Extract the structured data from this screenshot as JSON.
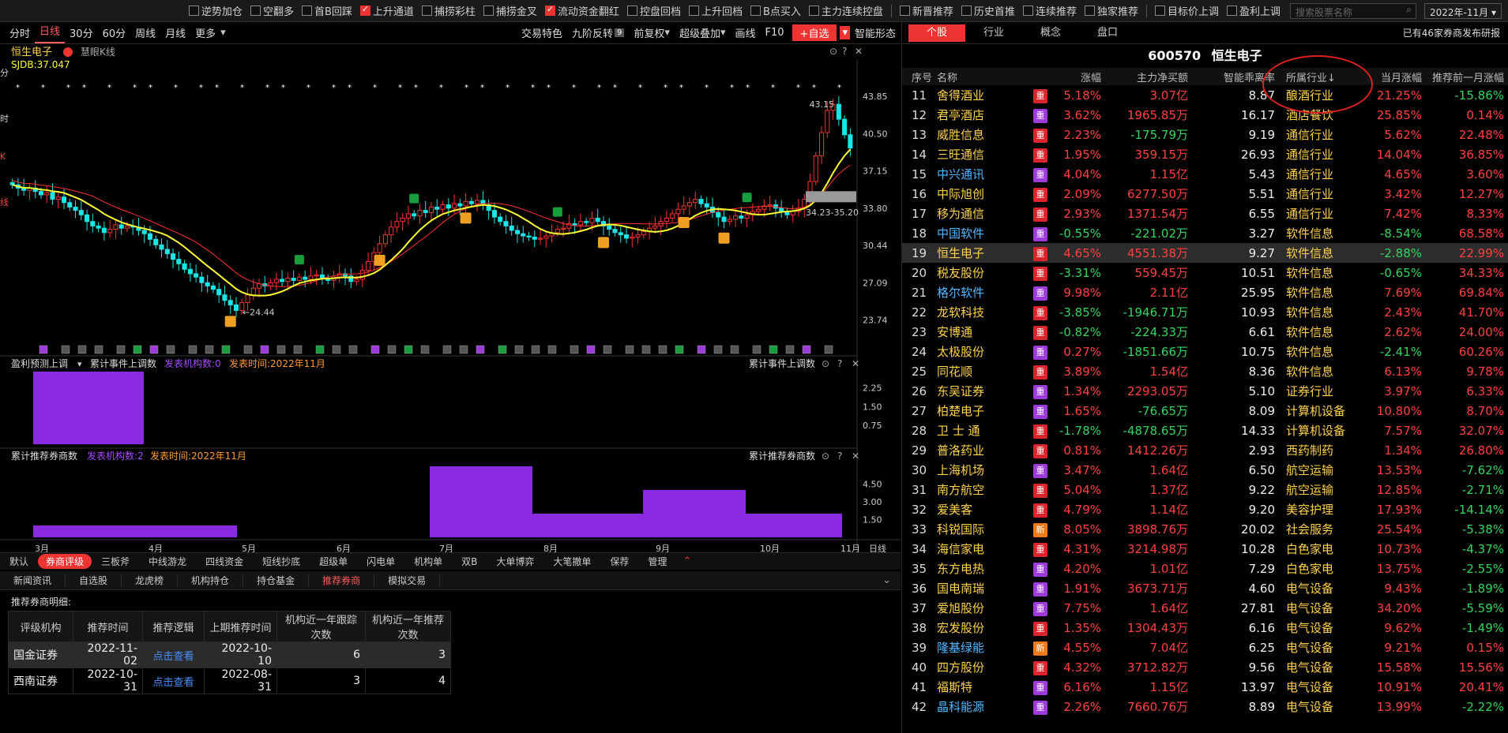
{
  "topbar": {
    "filters": [
      {
        "label": "逆势加仓",
        "checked": false
      },
      {
        "label": "空翻多",
        "checked": false
      },
      {
        "label": "首B回踩",
        "checked": false
      },
      {
        "label": "上升通道",
        "checked": true
      },
      {
        "label": "捕捞彩柱",
        "checked": false
      },
      {
        "label": "捕捞金叉",
        "checked": false
      },
      {
        "label": "流动资金翻红",
        "checked": true
      },
      {
        "label": "控盘回档",
        "checked": false
      },
      {
        "label": "上升回档",
        "checked": false
      },
      {
        "label": "B点买入",
        "checked": false
      },
      {
        "label": "主力连续控盘",
        "checked": false
      }
    ],
    "filters2": [
      {
        "label": "新晋推荐",
        "checked": false
      },
      {
        "label": "历史首推",
        "checked": false
      },
      {
        "label": "连续推荐",
        "checked": false
      },
      {
        "label": "独家推荐",
        "checked": false
      }
    ],
    "filters3": [
      {
        "label": "目标价上调",
        "checked": false
      },
      {
        "label": "盈利上调",
        "checked": false
      }
    ],
    "search_placeholder": "搜索股票名称",
    "date": "2022年-11月"
  },
  "left_toolbar": {
    "tabs_left": [
      "分时",
      "日线",
      "30分",
      "60分",
      "周线",
      "月线",
      "更多"
    ],
    "selected": "日线",
    "tabs_right": [
      "交易特色",
      "九阶反转",
      "前复权",
      "超级叠加",
      "画线",
      "F10"
    ],
    "nine_badge": "9",
    "add_label": "+自选",
    "smart_label": "智能形态"
  },
  "chart_header": {
    "stock_name": "恒生电子",
    "sub": "慧眼K线",
    "sjdb": "SJDB:37.047",
    "side_labels": [
      "分",
      "时",
      "K",
      "线"
    ]
  },
  "chart_data": [
    {
      "type": "candlestick",
      "y_ticks": [
        43.85,
        40.5,
        37.15,
        33.8,
        30.44,
        27.09,
        23.74
      ],
      "ylim": [
        23.0,
        45.0
      ],
      "annotations": [
        {
          "label": "43.15"
        },
        {
          "label": "24.44"
        },
        {
          "label": "34.23-35.20"
        }
      ],
      "x_labels": [
        "3月",
        "4月",
        "5月",
        "6月",
        "7月",
        "8月",
        "9月",
        "10月",
        "11月"
      ],
      "period_label": "日线",
      "close": [
        35.9,
        35.6,
        35.4,
        35.6,
        35.3,
        35.0,
        35.2,
        34.6,
        34.8,
        34.3,
        33.9,
        33.6,
        33.2,
        32.6,
        32.2,
        32.0,
        31.6,
        31.9,
        32.3,
        32.0,
        32.2,
        32.1,
        31.8,
        31.5,
        31.0,
        30.5,
        30.1,
        29.7,
        29.2,
        28.8,
        28.3,
        27.9,
        27.6,
        27.1,
        26.8,
        26.5,
        26.0,
        25.5,
        25.1,
        24.6,
        25.3,
        26.0,
        26.6,
        27.0,
        26.8,
        27.1,
        27.4,
        27.2,
        27.5,
        27.3,
        27.6,
        27.4,
        27.7,
        27.8,
        27.5,
        27.3,
        27.6,
        27.9,
        27.7,
        27.2,
        27.4,
        28.2,
        29.0,
        29.8,
        30.6,
        31.4,
        32.1,
        32.6,
        32.9,
        33.3,
        33.1,
        33.6,
        33.4,
        33.9,
        33.7,
        34.1,
        33.8,
        34.2,
        34.0,
        34.4,
        34.2,
        34.5,
        34.1,
        33.6,
        33.0,
        32.6,
        32.2,
        31.8,
        31.5,
        31.3,
        31.2,
        31.0,
        31.1,
        31.3,
        31.6,
        31.9,
        32.0,
        32.4,
        32.3,
        32.6,
        32.5,
        32.9,
        32.6,
        32.2,
        31.9,
        31.6,
        31.4,
        31.1,
        31.2,
        31.4,
        31.7,
        32.0,
        32.2,
        32.6,
        32.9,
        33.3,
        33.7,
        34.0,
        34.3,
        34.6,
        34.2,
        33.9,
        33.4,
        33.0,
        32.6,
        32.8,
        33.1,
        32.9,
        33.2,
        33.5,
        33.7,
        34.0,
        34.1,
        33.8,
        33.5,
        33.2,
        33.5,
        33.8,
        34.6,
        36.2,
        38.5,
        40.6,
        42.6,
        43.15,
        41.8,
        40.4,
        39.2
      ]
    },
    {
      "type": "bar",
      "title": "盈利预测上调",
      "legend": "累计事件上调数",
      "count_label": "发表机构数:0",
      "time_label": "发表时间:2022年11月",
      "right_title": "累计事件上调数",
      "y_ticks": [
        2.25,
        1.5,
        0.75
      ],
      "ylim": [
        0,
        2.9
      ],
      "categories": [
        "3月",
        "4月"
      ],
      "values": [
        3,
        0
      ]
    },
    {
      "type": "bar",
      "title": "累计推荐券商数",
      "count_label": "发表机构数:2",
      "time_label": "发表时间:2022年11月",
      "right_title": "累计推荐券商数",
      "y_ticks": [
        4.5,
        3.0,
        1.5
      ],
      "ylim": [
        0,
        6.2
      ],
      "categories": [
        "3月",
        "4月",
        "5月",
        "6月",
        "7月",
        "8月",
        "9月",
        "10月",
        "11月"
      ],
      "values": [
        1,
        1,
        0,
        0,
        6,
        2,
        4,
        2,
        2
      ]
    }
  ],
  "bottom_tabs": {
    "row1": [
      "默认",
      "券商评级",
      "三板斧",
      "中线游龙",
      "四线资金",
      "短线抄底",
      "超级单",
      "闪电单",
      "机构单",
      "双B",
      "大单博弈",
      "大笔撤单",
      "保荐",
      "管理"
    ],
    "row1_selected": "券商评级",
    "row2": [
      "新闻资讯",
      "自选股",
      "龙虎榜",
      "机构持仓",
      "持仓基金",
      "推荐券商",
      "模拟交易"
    ],
    "row2_selected": "推荐券商"
  },
  "broker_table": {
    "subtitle": "推荐券商明细:",
    "headers": [
      "评级机构",
      "推荐时间",
      "推荐逻辑",
      "上期推荐时间",
      "机构近一年跟踪次数",
      "机构近一年推荐次数"
    ],
    "rows": [
      [
        "国金证券",
        "2022-11-02",
        "点击查看",
        "2022-10-10",
        "6",
        "3"
      ],
      [
        "西南证券",
        "2022-10-31",
        "点击查看",
        "2022-08-31",
        "3",
        "4"
      ]
    ]
  },
  "right_panel": {
    "tabs": [
      "个股",
      "行业",
      "概念",
      "盘口"
    ],
    "selected": "个股",
    "note": "已有46家券商发布研报",
    "code": "600570",
    "name": "恒生电子",
    "headers": [
      "序号",
      "名称",
      "",
      "涨幅",
      "主力净买额",
      "智能乖离率",
      "所属行业↓",
      "当月涨幅",
      "推荐前一月涨幅"
    ],
    "rows": [
      [
        "11",
        "舍得酒业",
        "重",
        "5.18%",
        "3.07亿",
        "8.87",
        "酿酒行业",
        "21.25%",
        "-15.86%"
      ],
      [
        "12",
        "君亭酒店",
        "重",
        "3.62%",
        "1965.85万",
        "16.17",
        "酒店餐饮",
        "25.85%",
        "0.14%"
      ],
      [
        "13",
        "威胜信息",
        "重",
        "2.23%",
        "-175.79万",
        "9.19",
        "通信行业",
        "5.62%",
        "22.48%"
      ],
      [
        "14",
        "三旺通信",
        "重",
        "1.95%",
        "359.15万",
        "26.93",
        "通信行业",
        "14.04%",
        "36.85%"
      ],
      [
        "15",
        "中兴通讯",
        "重",
        "4.04%",
        "1.15亿",
        "5.43",
        "通信行业",
        "4.65%",
        "3.60%"
      ],
      [
        "16",
        "中际旭创",
        "重",
        "2.09%",
        "6277.50万",
        "5.51",
        "通信行业",
        "3.42%",
        "12.27%"
      ],
      [
        "17",
        "移为通信",
        "重",
        "2.93%",
        "1371.54万",
        "6.55",
        "通信行业",
        "7.42%",
        "8.33%"
      ],
      [
        "18",
        "中国软件",
        "重",
        "-0.55%",
        "-221.02万",
        "3.27",
        "软件信息",
        "-8.54%",
        "68.58%"
      ],
      [
        "19",
        "恒生电子",
        "重",
        "4.65%",
        "4551.38万",
        "9.27",
        "软件信息",
        "-2.88%",
        "22.99%"
      ],
      [
        "20",
        "税友股份",
        "重",
        "-3.31%",
        "559.45万",
        "10.51",
        "软件信息",
        "-0.65%",
        "34.33%"
      ],
      [
        "21",
        "格尔软件",
        "重",
        "9.98%",
        "2.11亿",
        "25.95",
        "软件信息",
        "7.69%",
        "69.84%"
      ],
      [
        "22",
        "龙软科技",
        "重",
        "-3.85%",
        "-1946.71万",
        "10.93",
        "软件信息",
        "2.43%",
        "41.70%"
      ],
      [
        "23",
        "安博通",
        "重",
        "-0.82%",
        "-224.33万",
        "6.61",
        "软件信息",
        "2.62%",
        "24.00%"
      ],
      [
        "24",
        "太极股份",
        "重",
        "0.27%",
        "-1851.66万",
        "10.75",
        "软件信息",
        "-2.41%",
        "60.26%"
      ],
      [
        "25",
        "同花顺",
        "重",
        "3.89%",
        "1.54亿",
        "8.36",
        "软件信息",
        "6.13%",
        "9.78%"
      ],
      [
        "26",
        "东吴证券",
        "重",
        "1.34%",
        "2293.05万",
        "5.10",
        "证券行业",
        "3.97%",
        "6.33%"
      ],
      [
        "27",
        "柏楚电子",
        "重",
        "1.65%",
        "-76.65万",
        "8.09",
        "计算机设备",
        "10.80%",
        "8.70%"
      ],
      [
        "28",
        "卫 士 通",
        "重",
        "-1.78%",
        "-4878.65万",
        "14.33",
        "计算机设备",
        "7.57%",
        "32.07%"
      ],
      [
        "29",
        "普洛药业",
        "重",
        "0.81%",
        "1412.26万",
        "2.93",
        "西药制药",
        "1.34%",
        "26.80%"
      ],
      [
        "30",
        "上海机场",
        "重",
        "3.47%",
        "1.64亿",
        "6.50",
        "航空运输",
        "13.53%",
        "-7.62%"
      ],
      [
        "31",
        "南方航空",
        "重",
        "5.04%",
        "1.37亿",
        "9.22",
        "航空运输",
        "12.85%",
        "-2.71%"
      ],
      [
        "32",
        "爱美客",
        "重",
        "4.79%",
        "1.14亿",
        "9.20",
        "美容护理",
        "17.93%",
        "-14.14%"
      ],
      [
        "33",
        "科锐国际",
        "新",
        "8.05%",
        "3898.76万",
        "20.02",
        "社会服务",
        "25.54%",
        "-5.38%"
      ],
      [
        "34",
        "海信家电",
        "重",
        "4.31%",
        "3214.98万",
        "10.28",
        "白色家电",
        "10.73%",
        "-4.37%"
      ],
      [
        "35",
        "东方电热",
        "重",
        "4.20%",
        "1.01亿",
        "7.29",
        "白色家电",
        "13.75%",
        "-2.55%"
      ],
      [
        "36",
        "国电南瑞",
        "重",
        "1.91%",
        "3673.71万",
        "4.60",
        "电气设备",
        "9.43%",
        "-1.89%"
      ],
      [
        "37",
        "爱旭股份",
        "重",
        "7.75%",
        "1.64亿",
        "27.81",
        "电气设备",
        "34.20%",
        "-5.59%"
      ],
      [
        "38",
        "宏发股份",
        "重",
        "1.35%",
        "1304.43万",
        "6.16",
        "电气设备",
        "9.62%",
        "-1.49%"
      ],
      [
        "39",
        "隆基绿能",
        "新",
        "4.55%",
        "7.04亿",
        "6.25",
        "电气设备",
        "9.21%",
        "0.15%"
      ],
      [
        "40",
        "四方股份",
        "重",
        "4.32%",
        "3712.82万",
        "9.56",
        "电气设备",
        "15.58%",
        "15.56%"
      ],
      [
        "41",
        "福斯特",
        "重",
        "6.16%",
        "1.15亿",
        "13.97",
        "电气设备",
        "10.91%",
        "20.41%"
      ],
      [
        "42",
        "晶科能源",
        "重",
        "2.26%",
        "7660.76万",
        "8.89",
        "电气设备",
        "13.99%",
        "-2.22%"
      ]
    ]
  },
  "colors": {
    "up": "#ff4040",
    "down": "#33d55f",
    "accent": "#e33",
    "bar": "#8a2be2",
    "ma5": "#ffff33",
    "ma10": "#ff3030"
  },
  "icons": [
    "search-icon",
    "close-icon",
    "help-icon",
    "settings-icon",
    "chevron-down-icon",
    "collapse-icon"
  ]
}
